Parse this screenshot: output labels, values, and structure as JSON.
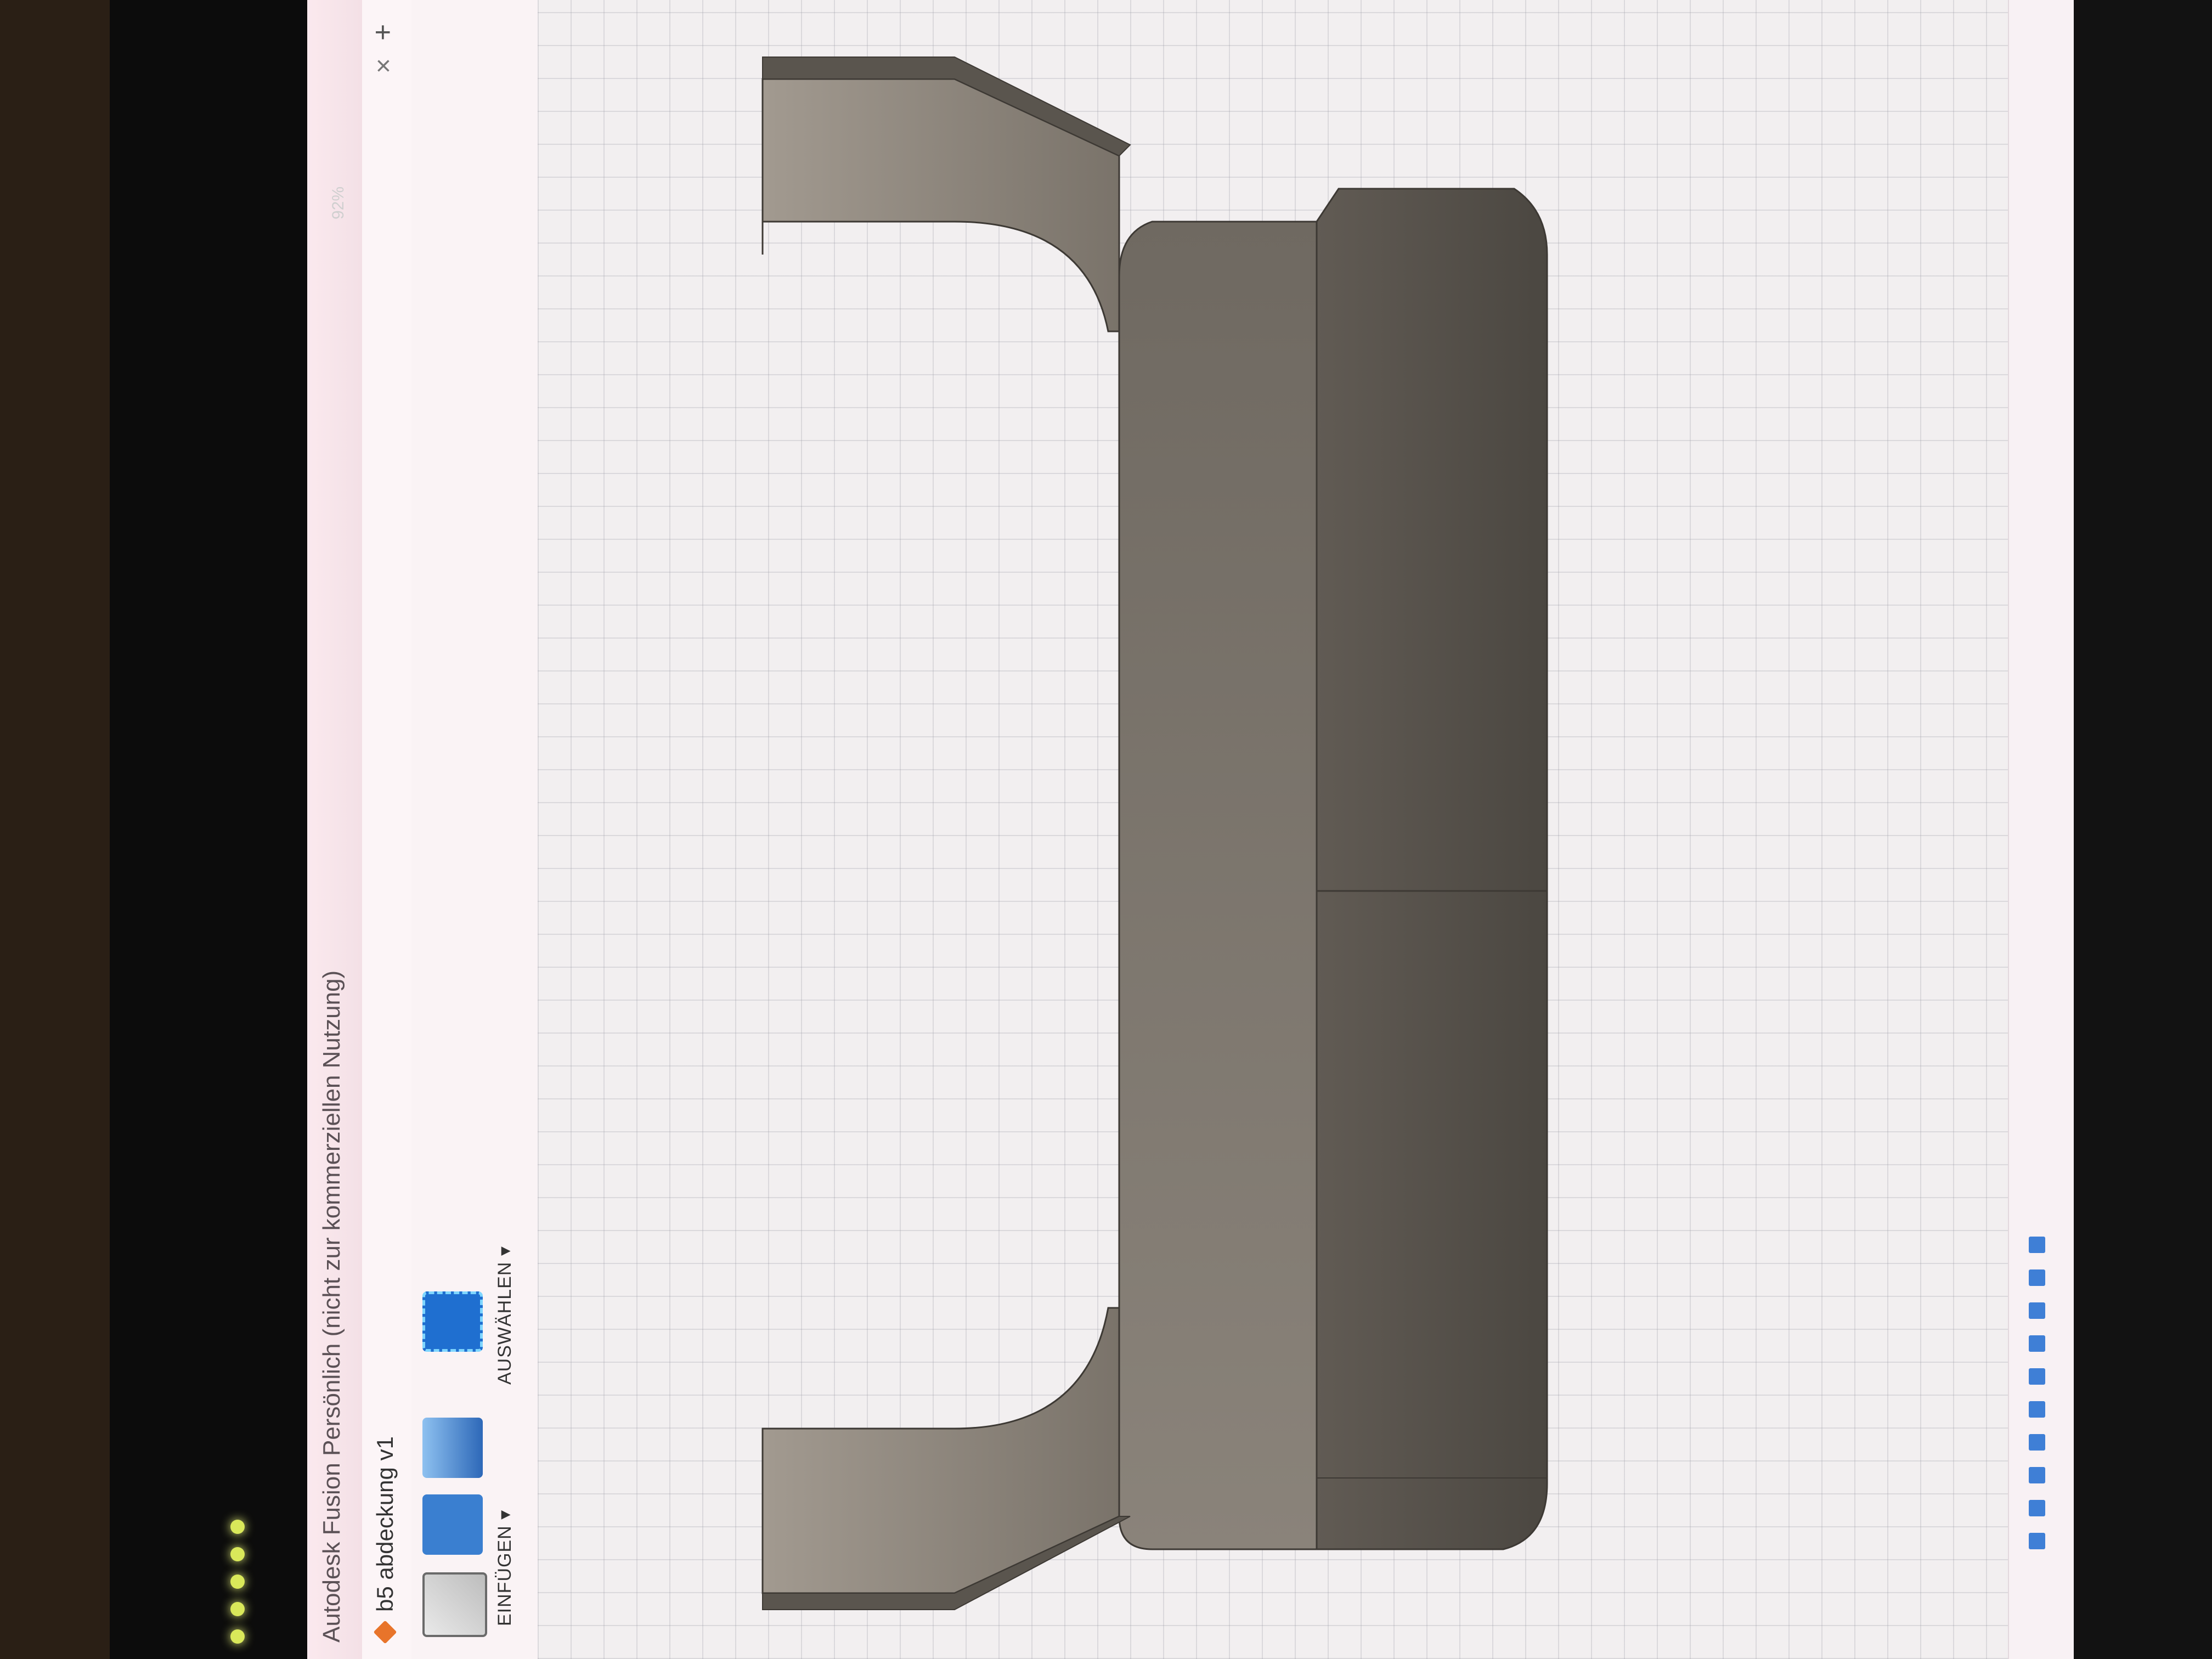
{
  "window": {
    "title": "Autodesk Fusion Persönlich (nicht zur kommerziellen Nutzung)"
  },
  "tabs": [
    {
      "label": "b5 abdeckung v1"
    }
  ],
  "toolbar": {
    "insert_label": "EINFÜGEN ▾",
    "select_label": "AUSWÄHLEN ▾"
  },
  "status": {
    "battery": "92%"
  },
  "colors": {
    "accent": "#1f6fd0",
    "part_face": "#7d776f",
    "part_dark": "#59544d",
    "grid_bg": "#f2eff0"
  },
  "icons": [
    "cube-icon",
    "close-icon",
    "plus-icon",
    "insert-derive-icon",
    "insert-mcmaster-icon",
    "insert-canvas-icon",
    "select-icon"
  ]
}
